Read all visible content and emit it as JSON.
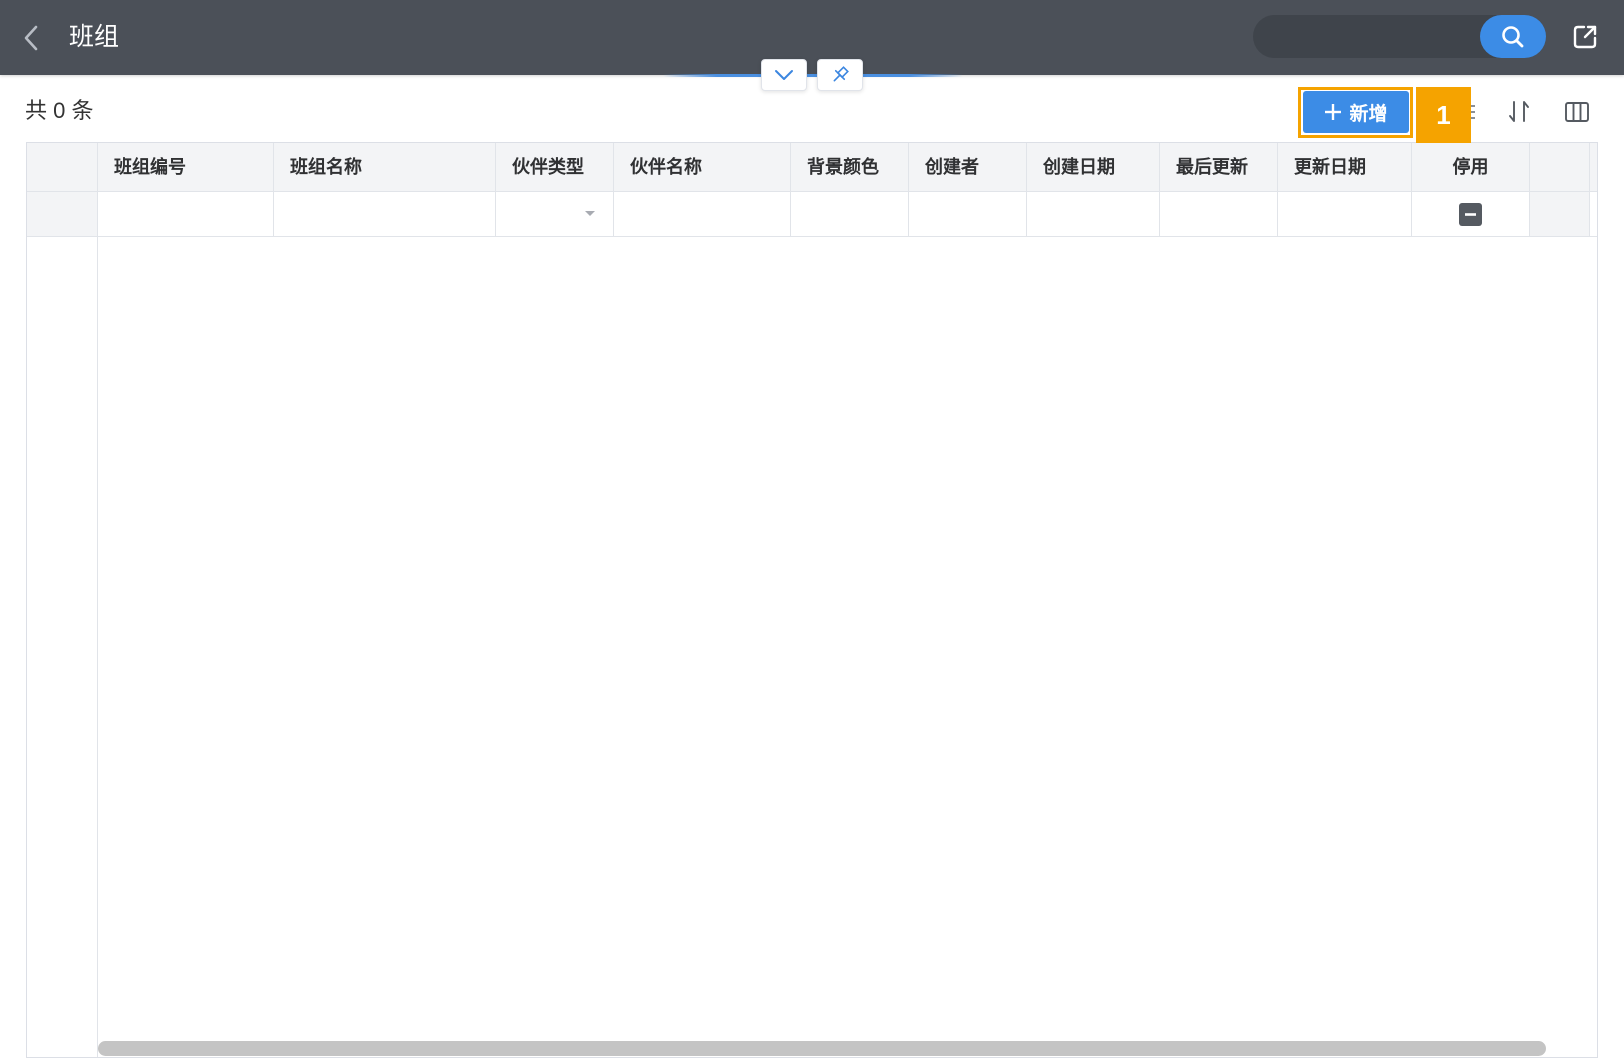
{
  "header": {
    "title": "班组",
    "search": {
      "value": ""
    }
  },
  "toolbar": {
    "record_count": "共 0 条",
    "add_label": "新增",
    "step_badge": "1"
  },
  "table": {
    "columns": [
      "班组编号",
      "班组名称",
      "伙伴类型",
      "伙伴名称",
      "背景颜色",
      "创建者",
      "创建日期",
      "最后更新",
      "更新日期",
      "停用"
    ],
    "filters": {
      "team_code": "",
      "team_name": "",
      "partner_type": "",
      "partner_name": "",
      "background_color": "",
      "creator": "",
      "created_date": "",
      "last_updated_by": "",
      "updated_date": ""
    },
    "rows": []
  },
  "icons": {
    "back": "chevron-left-icon",
    "search": "search-icon",
    "open_external": "external-link-icon",
    "collapse": "chevron-down-icon",
    "pin": "pin-icon",
    "add": "plus-icon",
    "filter_toggle": "list-icon",
    "sort": "sort-icon",
    "columns": "columns-icon",
    "partner_type_dropdown": "caret-down-icon",
    "disabled_filter": "minus-square-icon"
  },
  "colors": {
    "header_bg": "#4b5058",
    "primary": "#3c8ce6",
    "highlight": "#f5a300",
    "text": "#303133"
  }
}
